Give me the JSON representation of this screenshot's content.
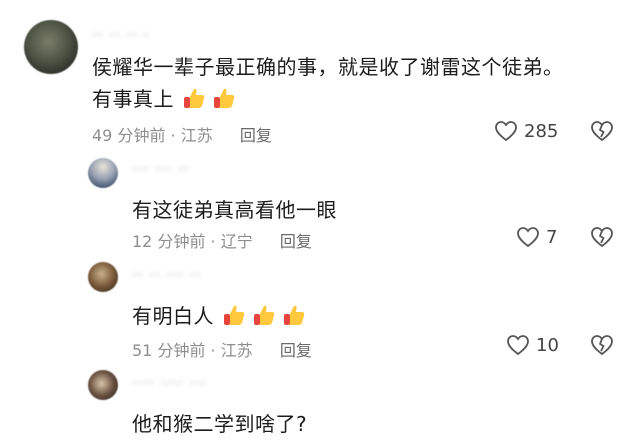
{
  "comments": [
    {
      "username": "·· ·· ·· ·",
      "text_line1": "侯耀华一辈子最正确的事，就是收了谢雷这个徒弟。",
      "text_line2": "有事真上",
      "emoji": [
        "thumbs-up-emoji",
        "thumbs-up-emoji"
      ],
      "time": "49 分钟前",
      "location": "江苏",
      "reply_label": "回复",
      "likes": "285"
    },
    {
      "username": "··· ··· ··",
      "text": "有这徒弟真高看他一眼",
      "time": "12 分钟前",
      "location": "辽宁",
      "reply_label": "回复",
      "likes": "7"
    },
    {
      "username": "·· ·· ··· ··",
      "text": "有明白人",
      "emoji": [
        "thumbs-up-emoji",
        "thumbs-up-emoji",
        "thumbs-up-emoji"
      ],
      "time": "51 分钟前",
      "location": "江苏",
      "reply_label": "回复",
      "likes": "10"
    },
    {
      "username": "···· ···· ···",
      "text": "他和猴二学到啥了?"
    }
  ],
  "separator": "·",
  "colors": {
    "emoji_yellow": "#FFC83D",
    "emoji_red": "#E8453C",
    "meta_gray": "#8e8e8e"
  }
}
